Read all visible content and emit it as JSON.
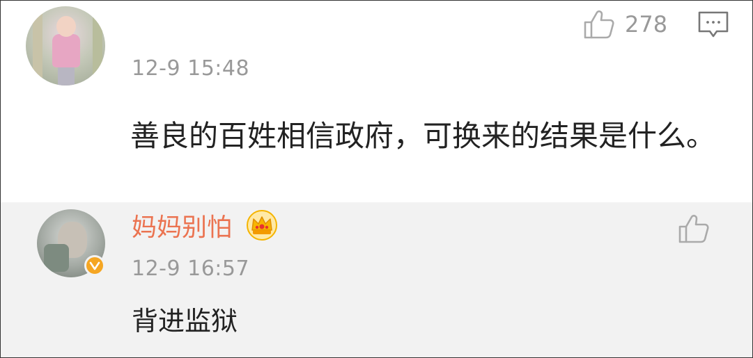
{
  "comment": {
    "timestamp": "12-9 15:48",
    "like_count": "278",
    "text": "善良的百姓相信政府，可换来的结果是什么。",
    "icons": {
      "like": "thumbs-up-icon",
      "reply": "comment-bubble-icon"
    }
  },
  "reply": {
    "username": "妈妈别怕",
    "timestamp": "12-9 16:57",
    "text": "背进监狱",
    "icons": {
      "vip": "crown-icon",
      "verified": "verified-badge-icon",
      "like": "thumbs-up-icon"
    },
    "colors": {
      "username": "#eb7350",
      "badge": "#f5a623",
      "background": "#f2f2f2"
    }
  }
}
